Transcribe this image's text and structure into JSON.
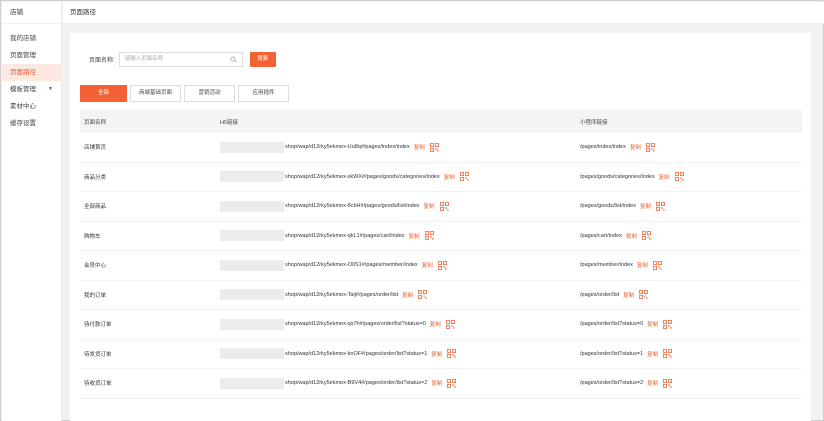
{
  "sidebar": {
    "title": "店铺",
    "items": [
      {
        "label": "我的店铺"
      },
      {
        "label": "页面管理"
      },
      {
        "label": "页面路径"
      },
      {
        "label": "模板管理"
      },
      {
        "label": "素材中心"
      },
      {
        "label": "缓存设置"
      }
    ]
  },
  "header": {
    "title": "页面路径"
  },
  "search": {
    "label": "页面名称:",
    "placeholder": "请输入页面名称",
    "button": "搜索"
  },
  "tabs": [
    {
      "label": "全部"
    },
    {
      "label": "商城基础页面"
    },
    {
      "label": "营销活动"
    },
    {
      "label": "应用插件"
    }
  ],
  "table": {
    "headers": [
      "页面名称",
      "H5链接",
      "小程序链接"
    ],
    "copy_label": "复制",
    "rows": [
      {
        "name": "店铺首页",
        "h5": "shop/wap/d12rky5ekmex-Uu8q#/pages/index/index",
        "mp": "/pages/index/index"
      },
      {
        "name": "商品分类",
        "h5": "shop/wap/d12rky5ekmex-skWX#/pages/goods/categories/index",
        "mp": "/pages/goods/categories/index"
      },
      {
        "name": "全部商品",
        "h5": "shop/wap/d12rky5ekmex-8cbH#/pages/goods/list/index",
        "mp": "/pages/goods/list/index"
      },
      {
        "name": "购物车",
        "h5": "shop/wap/d12rky5ekmex-qkL1#/pages/cart/index",
        "mp": "/pages/cart/index"
      },
      {
        "name": "会员中心",
        "h5": "shop/wap/d12rky5ekmex-O0S1#/pages/member/index",
        "mp": "/pages/member/index"
      },
      {
        "name": "我的订单",
        "h5": "shop/wap/d12rky5ekmex-Taij#/pages/order/list",
        "mp": "/pages/order/list"
      },
      {
        "name": "待付款订单",
        "h5": "shop/wap/d12rky5ekmex-qs7h#/pages/order/list?status=0",
        "mp": "/pages/order/list?status=0"
      },
      {
        "name": "待发货订单",
        "h5": "shop/wap/d12rky5ekmex-knOF#/pages/order/list?status=1",
        "mp": "/pages/order/list?status=1"
      },
      {
        "name": "待收货订单",
        "h5": "shop/wap/d12rky5ekmex-B9V4#/pages/order/list?status=2",
        "mp": "/pages/order/list?status=2"
      }
    ]
  },
  "colors": {
    "accent": "#f26234",
    "active_bg": "#fde8e2"
  }
}
